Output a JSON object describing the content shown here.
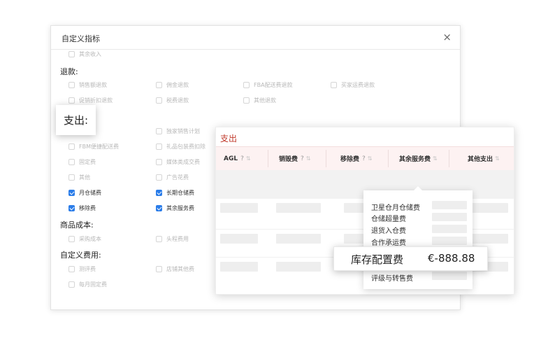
{
  "dialog": {
    "title": "自定义指标",
    "close_glyph": "×"
  },
  "sections": {
    "top_item": "其余收入",
    "refund": {
      "title": "退款:",
      "items": [
        "销售额退款",
        "佣金退款",
        "FBA配送费退款",
        "买家运费退款",
        "促销折扣退款",
        "税费退款",
        "其他退款"
      ]
    },
    "expense_partial": [
      "独家销售计划",
      "FBM便捷配送费",
      "礼品包装费扣除",
      "固定费",
      "媒体类成交费",
      "其他",
      "广告花费"
    ],
    "expense_checked": [
      "月仓储费",
      "长期仓储费",
      "移除费",
      "其余服务费"
    ],
    "cogs": {
      "title": "商品成本:",
      "items": [
        "采购成本",
        "头程费用"
      ]
    },
    "custom": {
      "title": "自定义费用:",
      "items": [
        "测评费",
        "店铺其他费",
        "每月固定费"
      ]
    }
  },
  "callout": {
    "label": "支出:"
  },
  "expense_table": {
    "title": "支出",
    "columns": [
      {
        "label": "AGL",
        "help": true
      },
      {
        "label": "销毁费",
        "help": true
      },
      {
        "label": "移除费",
        "help": true
      },
      {
        "label": "其余服务费",
        "help": false
      },
      {
        "label": "其他支出",
        "help": false
      }
    ],
    "help_glyph": "?",
    "sort_glyph": "⇅"
  },
  "dropdown": {
    "items": [
      "卫星仓月仓储费",
      "仓储超量费",
      "退货入仓费",
      "合作承运费",
      "评级与转售费"
    ]
  },
  "highlight": {
    "name": "库存配置费",
    "value": "€-888.88"
  },
  "colors": {
    "accent_blue": "#2b7de9",
    "title_red": "#c0392b",
    "header_bg": "#fdf2f2"
  }
}
